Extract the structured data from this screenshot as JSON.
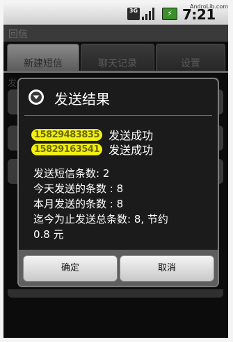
{
  "status_bar": {
    "network": "3G",
    "time": "7:21 AM",
    "watermark": "AndroLib.com",
    "icons": [
      "3g-icon",
      "signal-icon",
      "battery-charging-icon"
    ]
  },
  "app": {
    "title": "回信"
  },
  "tabs": [
    {
      "label": "新建短信",
      "active": true
    },
    {
      "label": "聊天记录",
      "active": false
    },
    {
      "label": "设置",
      "active": false
    }
  ],
  "background": {
    "label_fragment": "发"
  },
  "dialog": {
    "title": "发送结果",
    "icon": "chevron-down-circle-icon",
    "results": [
      {
        "phone": "15829483835",
        "status": "发送成功"
      },
      {
        "phone": "15829163541",
        "status": "发送成功"
      }
    ],
    "stats": [
      "发送短信条数: 2",
      "今天发送的条数 : 8",
      "本月发送的条数 : 8",
      "迄今为止发送总条数: 8, 节约",
      "0.8 元"
    ],
    "buttons": {
      "confirm": "确定",
      "cancel": "取消"
    }
  },
  "colors": {
    "highlight": "#f2ef13",
    "dialog_bg": "#1b1b1b",
    "button_bar": "#5e5e5e"
  }
}
